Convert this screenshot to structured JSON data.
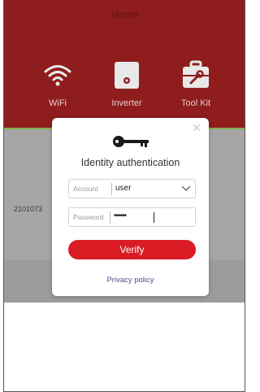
{
  "header": {
    "title": "Home",
    "nav": [
      {
        "label": "WiFi",
        "icon": "wifi-icon"
      },
      {
        "label": "Inverter",
        "icon": "inverter-icon"
      },
      {
        "label": "Tool Kit",
        "icon": "toolkit-icon"
      }
    ]
  },
  "content": {
    "serial": "2101073"
  },
  "modal": {
    "icon": "key-icon",
    "title": "Identity authentication",
    "account": {
      "label": "Account",
      "value": "user"
    },
    "password": {
      "label": "Password",
      "value": "••••••"
    },
    "verify_label": "Verify",
    "privacy_label": "Privacy policy",
    "close_icon": "close-icon"
  },
  "colors": {
    "header": "#8f1d1d",
    "accent": "#d91c24",
    "link": "#4a4f8a",
    "divider": "#7fb24a"
  }
}
